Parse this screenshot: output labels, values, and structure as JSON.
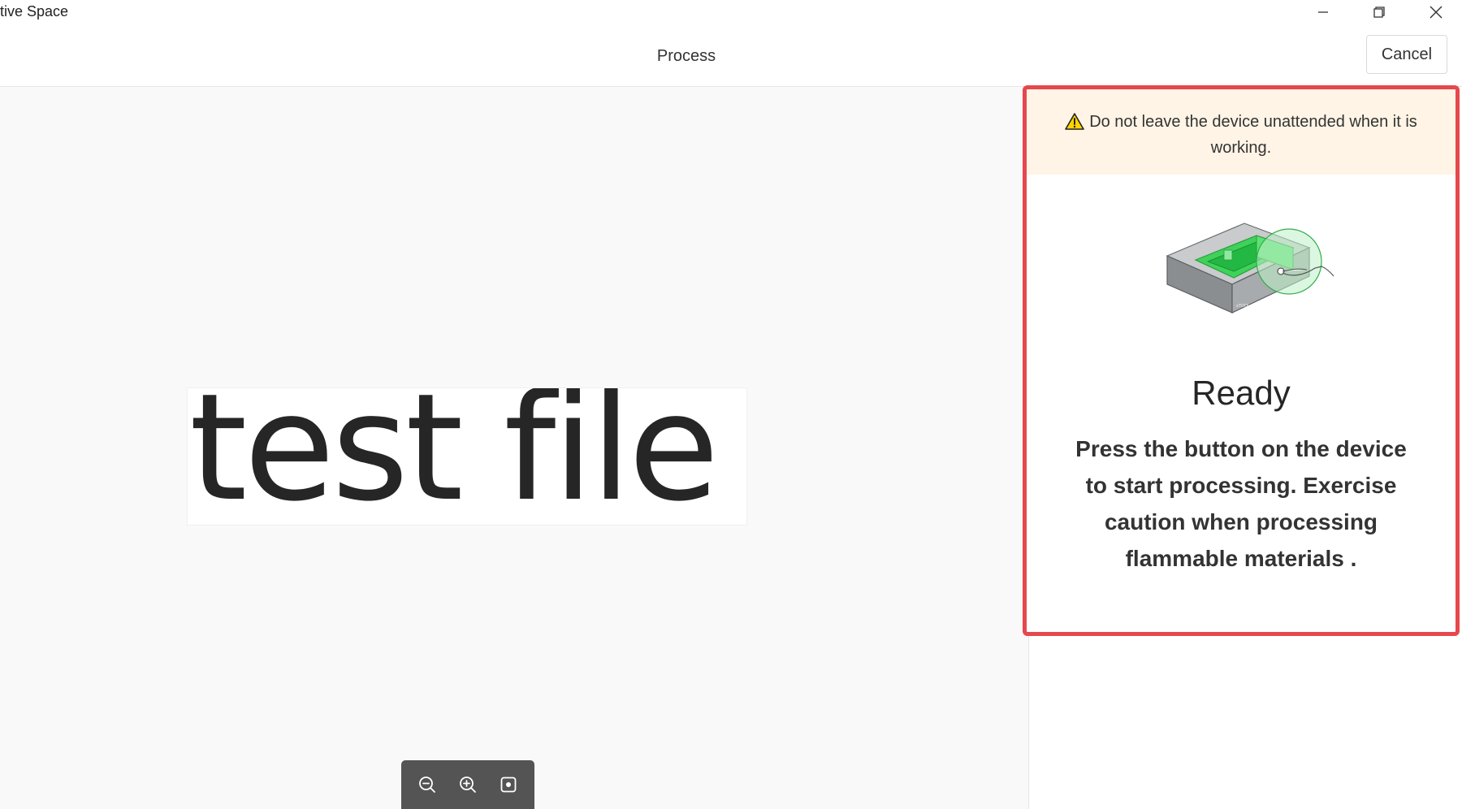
{
  "window": {
    "title": "tive Space",
    "controls": {
      "minimize_icon": "minimize-icon",
      "restore_icon": "restore-icon",
      "close_icon": "close-icon"
    }
  },
  "header": {
    "title": "Process",
    "cancel_label": "Cancel"
  },
  "canvas": {
    "preview_text": "test file",
    "zoom_controls": [
      "zoom-out-icon",
      "zoom-in-icon",
      "fit-to-center-icon"
    ]
  },
  "panel": {
    "highlight_color": "#e5484d",
    "warning": {
      "icon": "warning-icon",
      "text": "Do not leave the device unattended when it is working.",
      "background": "#fff4e6"
    },
    "illustration": "device-button-press-illustration",
    "status_title": "Ready",
    "status_description": "Press the button on the device to start processing. Exercise caution when processing flammable materials ."
  }
}
